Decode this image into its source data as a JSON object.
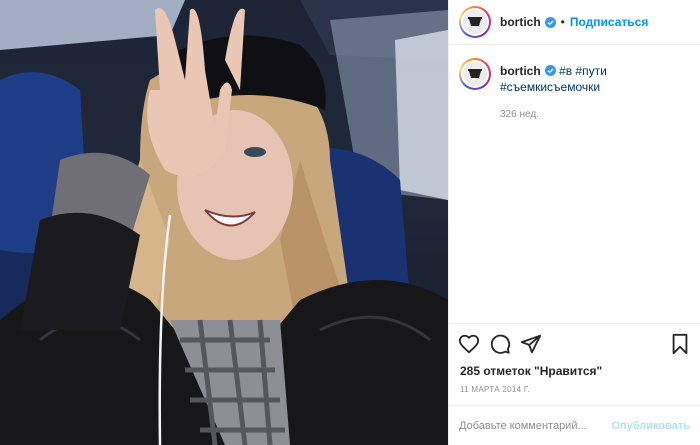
{
  "post": {
    "photo_alt": "",
    "author": {
      "username": "bortich",
      "verified": true,
      "avatar_text": "bortich"
    },
    "header": {
      "separator": "•",
      "follow_label": "Подписаться"
    },
    "caption": {
      "username": "bortich",
      "hashtags": [
        "#в",
        "#пути",
        "#съемкисъемочки"
      ],
      "age": "326 нед."
    },
    "actions": {
      "icons": [
        "heart-icon",
        "comment-icon",
        "share-icon",
        "bookmark-icon"
      ]
    },
    "likes_text": "285 отметок \"Нравится\"",
    "date_text": "11 МАРТА 2014 Г.",
    "comment_box": {
      "placeholder": "Добавьте комментарий...",
      "publish_label": "Опубликовать"
    }
  },
  "colors": {
    "link_blue": "#0095f6",
    "hashtag_blue": "#00376b",
    "muted_gray": "#8e8e8e",
    "publish_disabled": "#b2dffc",
    "border": "#efefef"
  }
}
